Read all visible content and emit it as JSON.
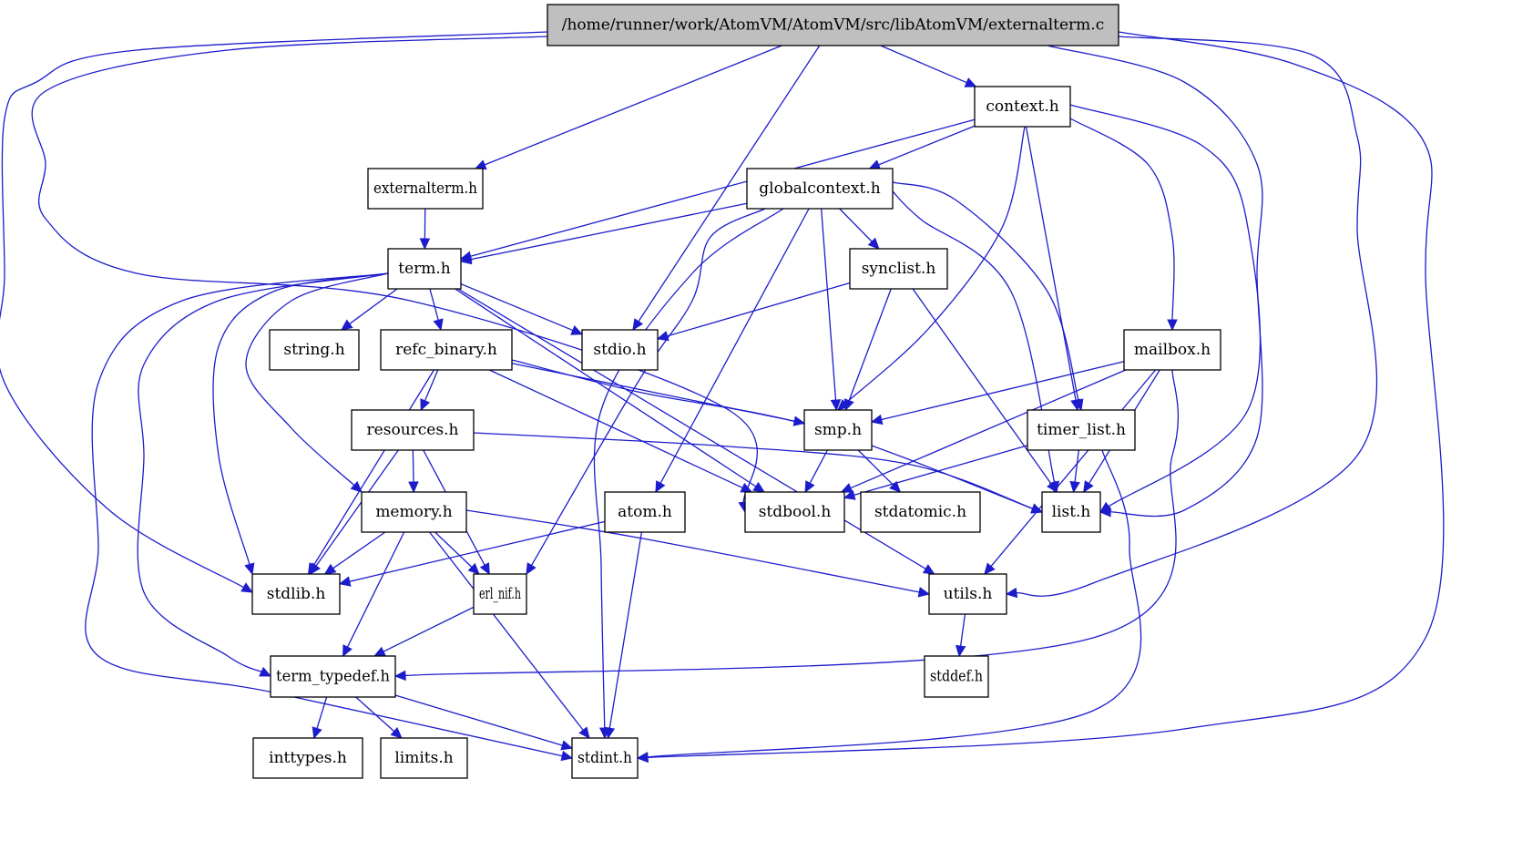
{
  "title": "/home/runner/work/AtomVM/AtomVM/src/libAtomVM/externalterm.c",
  "colors": {
    "edge": "#1c1ccd",
    "root_fill": "#bfbfbf",
    "node_fill": "#ffffff",
    "node_stroke": "#000000"
  },
  "nodes": [
    {
      "id": "root",
      "label": "/home/runner/work/AtomVM/AtomVM/src/libAtomVM/externalterm.c",
      "root": true
    },
    {
      "id": "context",
      "label": "context.h"
    },
    {
      "id": "externalterm",
      "label": "externalterm.h"
    },
    {
      "id": "globalcontext",
      "label": "globalcontext.h"
    },
    {
      "id": "term",
      "label": "term.h"
    },
    {
      "id": "synclist",
      "label": "synclist.h"
    },
    {
      "id": "string",
      "label": "string.h"
    },
    {
      "id": "refc_binary",
      "label": "refc_binary.h"
    },
    {
      "id": "stdio",
      "label": "stdio.h"
    },
    {
      "id": "mailbox",
      "label": "mailbox.h"
    },
    {
      "id": "resources",
      "label": "resources.h"
    },
    {
      "id": "smp",
      "label": "smp.h"
    },
    {
      "id": "timer_list",
      "label": "timer_list.h"
    },
    {
      "id": "memory",
      "label": "memory.h"
    },
    {
      "id": "atom",
      "label": "atom.h"
    },
    {
      "id": "stdbool",
      "label": "stdbool.h"
    },
    {
      "id": "stdatomic",
      "label": "stdatomic.h"
    },
    {
      "id": "list",
      "label": "list.h"
    },
    {
      "id": "stdlib",
      "label": "stdlib.h"
    },
    {
      "id": "erl_nif",
      "label": "erl_nif.h"
    },
    {
      "id": "utils",
      "label": "utils.h"
    },
    {
      "id": "term_typedef",
      "label": "term_typedef.h"
    },
    {
      "id": "stddef",
      "label": "stddef.h"
    },
    {
      "id": "inttypes",
      "label": "inttypes.h"
    },
    {
      "id": "limits",
      "label": "limits.h"
    },
    {
      "id": "stdint",
      "label": "stdint.h"
    }
  ],
  "edges": [
    [
      "root",
      "context"
    ],
    [
      "root",
      "externalterm"
    ],
    [
      "root",
      "stdio"
    ],
    [
      "root",
      "stdlib"
    ],
    [
      "root",
      "stdbool"
    ],
    [
      "root",
      "list"
    ],
    [
      "root",
      "utils"
    ],
    [
      "root",
      "stdint"
    ],
    [
      "context",
      "globalcontext"
    ],
    [
      "context",
      "term"
    ],
    [
      "context",
      "smp"
    ],
    [
      "context",
      "timer_list"
    ],
    [
      "context",
      "list"
    ],
    [
      "context",
      "mailbox"
    ],
    [
      "externalterm",
      "term"
    ],
    [
      "globalcontext",
      "term"
    ],
    [
      "globalcontext",
      "synclist"
    ],
    [
      "globalcontext",
      "smp"
    ],
    [
      "globalcontext",
      "atom"
    ],
    [
      "globalcontext",
      "erl_nif"
    ],
    [
      "globalcontext",
      "stdint"
    ],
    [
      "globalcontext",
      "list"
    ],
    [
      "globalcontext",
      "timer_list"
    ],
    [
      "term",
      "string"
    ],
    [
      "term",
      "refc_binary"
    ],
    [
      "term",
      "stdio"
    ],
    [
      "term",
      "memory"
    ],
    [
      "term",
      "stdlib"
    ],
    [
      "term",
      "stdbool"
    ],
    [
      "term",
      "utils"
    ],
    [
      "term",
      "term_typedef"
    ],
    [
      "term",
      "stdint"
    ],
    [
      "synclist",
      "stdio"
    ],
    [
      "synclist",
      "smp"
    ],
    [
      "synclist",
      "list"
    ],
    [
      "refc_binary",
      "resources"
    ],
    [
      "refc_binary",
      "stdlib"
    ],
    [
      "refc_binary",
      "smp"
    ],
    [
      "refc_binary",
      "stdbool"
    ],
    [
      "refc_binary",
      "list"
    ],
    [
      "mailbox",
      "smp"
    ],
    [
      "mailbox",
      "stdbool"
    ],
    [
      "mailbox",
      "list"
    ],
    [
      "mailbox",
      "utils"
    ],
    [
      "mailbox",
      "term_typedef"
    ],
    [
      "resources",
      "memory"
    ],
    [
      "resources",
      "stdlib"
    ],
    [
      "resources",
      "erl_nif"
    ],
    [
      "resources",
      "list"
    ],
    [
      "smp",
      "stdbool"
    ],
    [
      "smp",
      "stdatomic"
    ],
    [
      "timer_list",
      "stdbool"
    ],
    [
      "timer_list",
      "list"
    ],
    [
      "timer_list",
      "stdint"
    ],
    [
      "memory",
      "stdlib"
    ],
    [
      "memory",
      "erl_nif"
    ],
    [
      "memory",
      "utils"
    ],
    [
      "memory",
      "term_typedef"
    ],
    [
      "memory",
      "stdint"
    ],
    [
      "atom",
      "stdlib"
    ],
    [
      "atom",
      "stdint"
    ],
    [
      "erl_nif",
      "term_typedef"
    ],
    [
      "utils",
      "stddef"
    ],
    [
      "term_typedef",
      "inttypes"
    ],
    [
      "term_typedef",
      "limits"
    ],
    [
      "term_typedef",
      "stdint"
    ]
  ]
}
